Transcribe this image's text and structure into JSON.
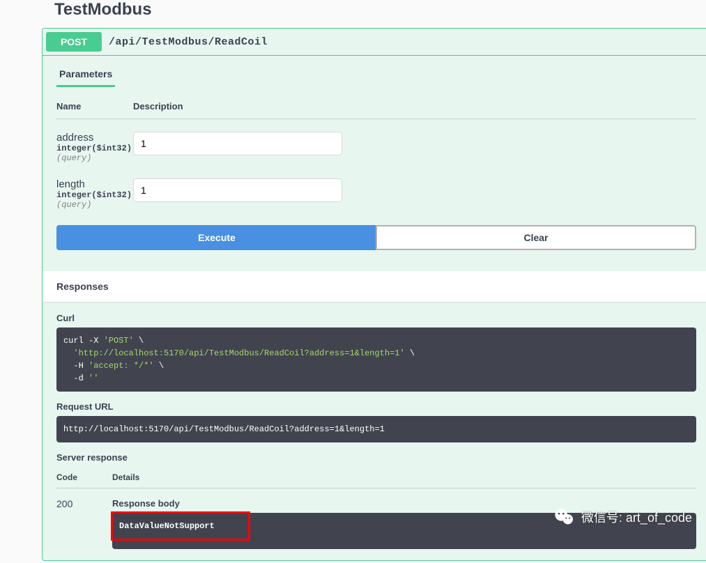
{
  "title": "TestModbus",
  "operation": {
    "method": "POST",
    "path": "/api/TestModbus/ReadCoil"
  },
  "tabs": {
    "parameters": "Parameters"
  },
  "paramHeaders": {
    "name": "Name",
    "description": "Description"
  },
  "params": [
    {
      "name": "address",
      "type": "integer($int32)",
      "in": "(query)",
      "value": "1"
    },
    {
      "name": "length",
      "type": "integer($int32)",
      "in": "(query)",
      "value": "1"
    }
  ],
  "buttons": {
    "execute": "Execute",
    "clear": "Clear"
  },
  "responsesTitle": "Responses",
  "curl": {
    "label": "Curl",
    "line1a": "curl -X ",
    "line1b": "'POST'",
    "line1c": " \\",
    "line2a": "  ",
    "line2b": "'http://localhost:5170/api/TestModbus/ReadCoil?address=1&length=1'",
    "line2c": " \\",
    "line3a": "  -H ",
    "line3b": "'accept: */*'",
    "line3c": " \\",
    "line4a": "  -d ",
    "line4b": "''"
  },
  "requestUrl": {
    "label": "Request URL",
    "value": "http://localhost:5170/api/TestModbus/ReadCoil?address=1&length=1"
  },
  "serverResponse": {
    "label": "Server response",
    "headers": {
      "code": "Code",
      "details": "Details"
    },
    "code": "200",
    "bodyLabel": "Response body",
    "body": "DataValueNotSupport"
  },
  "watermark": "微信号: art_of_code"
}
